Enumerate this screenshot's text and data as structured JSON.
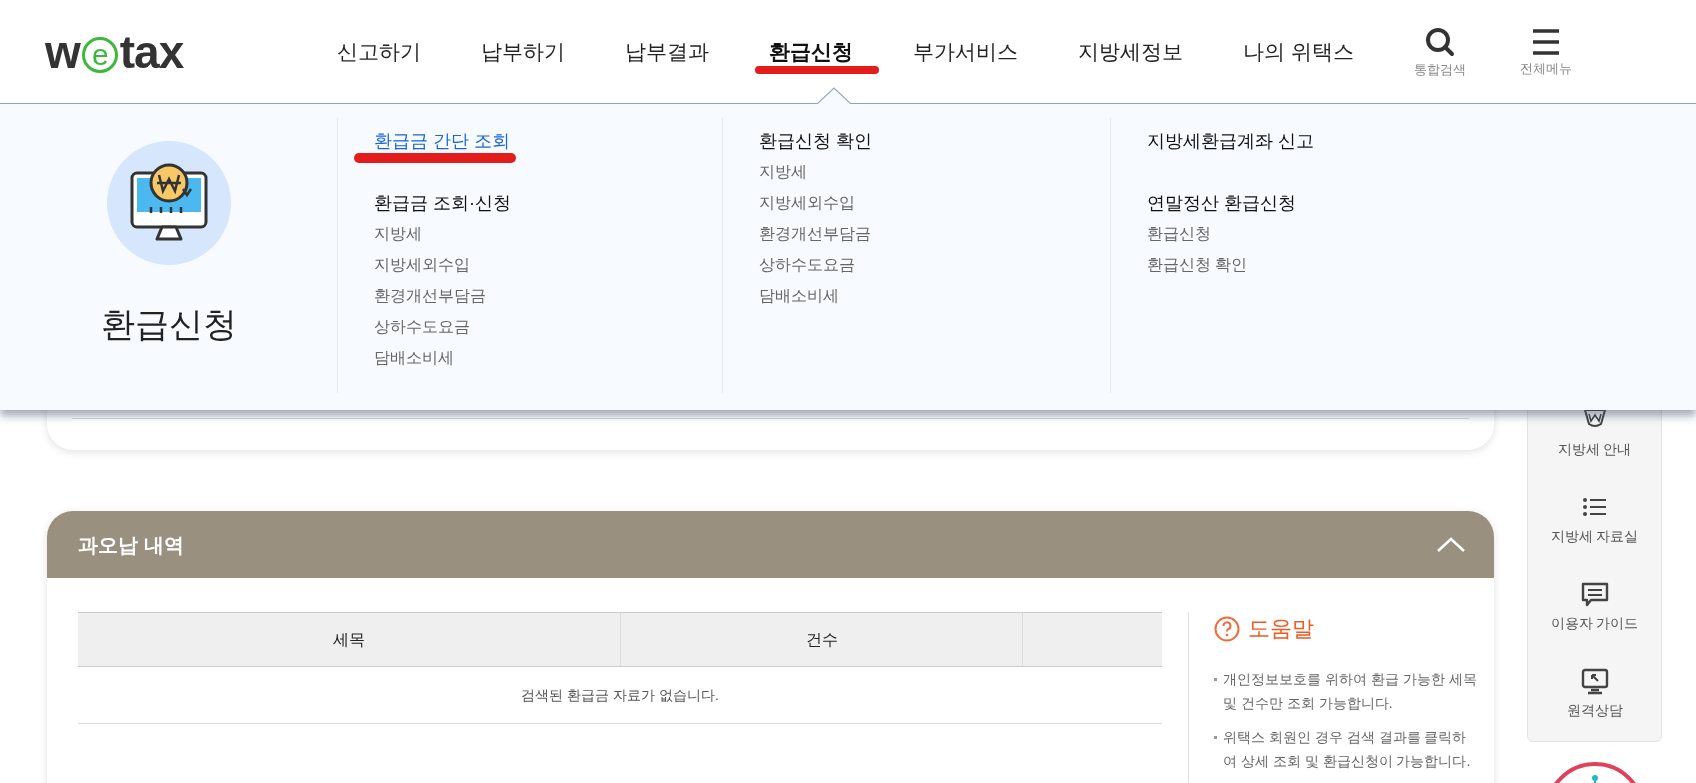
{
  "header": {
    "logo": [
      {
        "text": "w",
        "kind": "plain"
      },
      {
        "text": "e",
        "kind": "circled"
      },
      {
        "text": "tax",
        "kind": "plain"
      }
    ],
    "nav": [
      {
        "label": "신고하기",
        "selected": false,
        "marked": false
      },
      {
        "label": "납부하기",
        "selected": false,
        "marked": false
      },
      {
        "label": "납부결과",
        "selected": false,
        "marked": false
      },
      {
        "label": "환급신청",
        "selected": true,
        "marked": true
      },
      {
        "label": "부가서비스",
        "selected": false,
        "marked": false
      },
      {
        "label": "지방세정보",
        "selected": false,
        "marked": false
      },
      {
        "label": "나의 위택스",
        "selected": false,
        "marked": false
      }
    ],
    "tools": [
      {
        "label": "통합검색",
        "kind": "search"
      },
      {
        "label": "전체메뉴",
        "kind": "menu"
      }
    ]
  },
  "mega_menu": {
    "title": "환급신청",
    "columns": [
      {
        "groups": [
          {
            "heading": "환급금 간단 조회",
            "kind": "link",
            "marked": true
          },
          {
            "heading": "환급금 조회·신청",
            "kind": "heading",
            "marked": false,
            "items": [
              "지방세",
              "지방세외수입",
              "환경개선부담금",
              "상하수도요금",
              "담배소비세"
            ]
          }
        ]
      },
      {
        "groups": [
          {
            "heading": "환급신청 확인",
            "kind": "heading",
            "marked": false,
            "items": [
              "지방세",
              "지방세외수입",
              "환경개선부담금",
              "상하수도요금",
              "담배소비세"
            ]
          }
        ]
      },
      {
        "groups": [
          {
            "heading": "지방세환급계좌 신고",
            "kind": "heading",
            "marked": false
          },
          {
            "heading": "연말정산 환급신청",
            "kind": "heading",
            "marked": false,
            "items": [
              "환급신청",
              "환급신청 확인"
            ]
          }
        ]
      }
    ]
  },
  "section": {
    "title": "과오납 내역",
    "expanded": true,
    "table": {
      "columns": [
        "세목",
        "건수"
      ],
      "empty_message": "검색된 환급금 자료가 없습니다."
    },
    "help": {
      "title": "도움말",
      "notes": [
        "개인정보보호를 위하여 환급 가능한 세목 및 건수만 조회 가능합니다.",
        "위택스 회원인 경우 검색 결과를 클릭하여 상세 조회 및 환급신청이 가능합니다."
      ]
    }
  },
  "quick_menu": [
    {
      "label": "지방세 안내",
      "kind": "won"
    },
    {
      "label": "지방세 자료실",
      "kind": "list"
    },
    {
      "label": "이용자 가이드",
      "kind": "chat"
    },
    {
      "label": "원격상담",
      "kind": "remote"
    }
  ]
}
